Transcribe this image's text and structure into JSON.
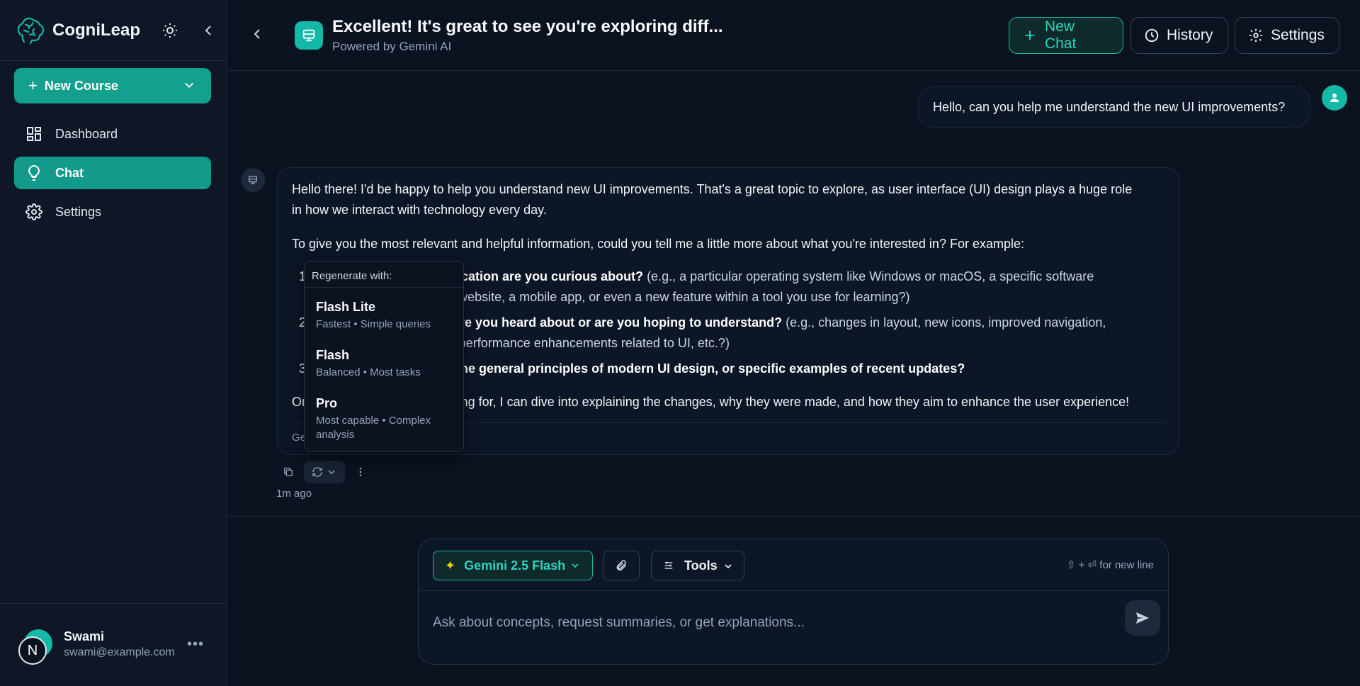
{
  "brand": {
    "name": "CogniLeap"
  },
  "sidebar": {
    "new_course_label": "New Course",
    "items": [
      {
        "label": "Dashboard",
        "icon": "dashboard-icon"
      },
      {
        "label": "Chat",
        "icon": "lightbulb-icon",
        "active": true
      },
      {
        "label": "Settings",
        "icon": "gear-icon"
      }
    ],
    "user": {
      "initial": "N",
      "name": "Swami",
      "email": "swami@example.com"
    }
  },
  "header": {
    "title": "Excellent! It's great to see you're exploring diff...",
    "subtitle": "Powered by Gemini AI",
    "new_chat_label": "New Chat",
    "history_label": "History",
    "settings_label": "Settings"
  },
  "messages": {
    "user_text": "Hello, can you help me understand the new UI improvements?",
    "ai": {
      "para1_line1": "Hello there! I'd be happy to help you understand new UI improvements. That's a great topic to explore, as user interface (UI) design plays a huge role",
      "para1_line2": "in how we interact with technology every day.",
      "para2": "To give you the most relevant and helpful information, could you tell me a little more about what you're interested in? For example:",
      "list": [
        {
          "num": "1.",
          "bold": "Which software or application are you curious about?",
          "rest": " (e.g., a particular operating system like Windows or macOS, a specific software",
          "line2": "like Adobe Photoshop, a website, a mobile app, or even a new feature within a tool you use for learning?)"
        },
        {
          "num": "2.",
          "bold": "What improvements have you heard about or are you hoping to understand?",
          "rest": " (e.g., changes in layout, new icons, improved navigation,",
          "line2": "accessibility, dark mode, performance enhancements related to UI, etc.?)"
        },
        {
          "num": "3.",
          "bold": "Are you curious about the general principles of modern UI design, or specific examples of recent updates?",
          "rest": "",
          "line2": ""
        }
      ],
      "para3": "Once I know what you're looking for, I can dive into explaining the changes, why they were made, and how they aim to enhance the user experience!",
      "footer": "Ge"
    },
    "time_ago": "1m ago"
  },
  "regen_menu": {
    "heading": "Regenerate with:",
    "options": [
      {
        "title": "Flash Lite",
        "desc": "Fastest • Simple queries"
      },
      {
        "title": "Flash",
        "desc": "Balanced • Most tasks"
      },
      {
        "title": "Pro",
        "desc": "Most capable • Complex analysis"
      }
    ]
  },
  "composer": {
    "model_label": "Gemini 2.5 Flash",
    "tools_label": "Tools",
    "hint": "⇧ + ⏎ for new line",
    "placeholder": "Ask about concepts, request summaries, or get explanations..."
  },
  "colors": {
    "accent": "#14b8a6",
    "background": "#0b1220",
    "sidebar": "#0f1726"
  }
}
